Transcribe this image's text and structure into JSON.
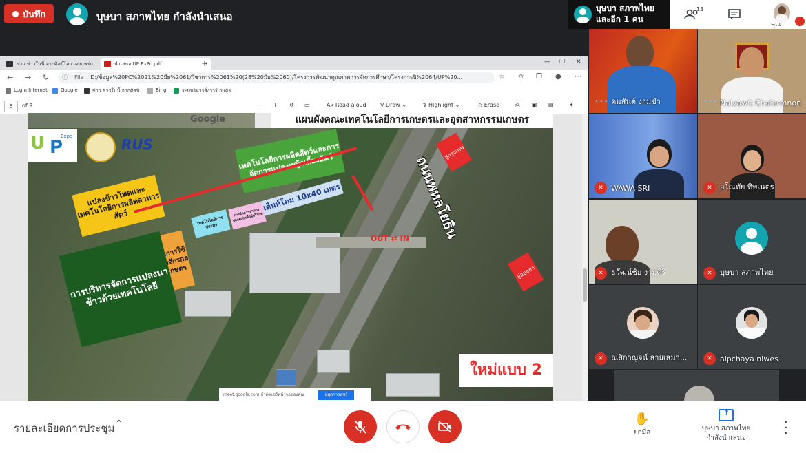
{
  "topbar": {
    "record_label": "บันทึก",
    "presenter_status": "บุษบา สภาพไทย กำลังนำเสนอ",
    "pinned": {
      "line1": "บุษบา สภาพไทย",
      "line2": "และอีก 1 คน"
    },
    "participants_count": "13",
    "me_label": "คุณ"
  },
  "browser": {
    "tabs": [
      {
        "label": "ข่าว ข่าวในนี้ จากศิลป์โลก เผยแพร่ภ..."
      },
      {
        "label": "นำเสนอ UP ExPo.pdf"
      }
    ],
    "address": {
      "prefix": "File",
      "url": "D:/ข้อมูล%20PC%2021%20มีย%2061/วิชาการ%2061%20(28%20มีย%2060)/โครงการพัฒนาคุณภาพการจัดการศึกษา/โครงการปี%2064/UP%20..."
    },
    "bookmarks": [
      "Login Internet",
      "Google",
      "ข่าว ข่าวในนี้ จากศิลป์...",
      "Bing",
      "ระบบริหารสิ่งวารีเกษตร..."
    ],
    "pdf": {
      "page": "6",
      "of": "of 9",
      "tools": [
        "Read aloud",
        "Draw",
        "Highlight",
        "Erase"
      ]
    }
  },
  "slide": {
    "google": "Google",
    "title": "แผนผังคณะเทคโนโลยีการเกษตรและอุตสาหกรรมเกษตร",
    "logo_u": "U",
    "logo_p": "P",
    "logo_expo": "Expo",
    "rus": "RUS",
    "labels": {
      "green_top": "เทคโนโลยีการผลิตสัตว์และการจัดการแปลงหญ้าเลี้ยงสัตว์",
      "yellow_left": "แปลงข้าวโพดและเทคโนโลยีการผลิตอาหารสัตว์",
      "tent": "เต็นท์โดม 10x40 เมตร",
      "cyan": "เทคโนโลยีการประมง",
      "pink": "การจัดการอาหารปลอดภัยเพื่อผู้บริโภค",
      "orange": "สาธิตการใช้เครื่องจักรกลการเกษตร",
      "green_big": "การบริหารจัดการแปลงนาข้าวด้วยเทคโนโลยี",
      "road": "ถนนพหลโยธิน",
      "out_in": "OUT ⇄ IN",
      "to_city_top": "สู่กรุงเทพ",
      "to_city_bottom": "สู่อยุธยา",
      "new_design": "ใหม่แบบ 2"
    },
    "share_bar": {
      "text": "meet.google.com กำลังแชร์หน้าจอของคุณ",
      "button": "หยุดการแชร์"
    }
  },
  "participants": [
    {
      "name": "คมสันต์ งามขำ",
      "status": "speaking"
    },
    {
      "name": "Naiyawit Chalermnon",
      "status": "speaking"
    },
    {
      "name": "WAWA SRI",
      "status": "muted"
    },
    {
      "name": "อโณทัย ทิพเนตร",
      "status": "muted"
    },
    {
      "name": "ธวัฒน์ชัย งามศิริ",
      "status": "muted"
    },
    {
      "name": "บุษบา สภาพไทย",
      "status": "muted"
    },
    {
      "name": "ณสิกาญจน์ สายเสมา...",
      "status": "muted"
    },
    {
      "name": "aipchaya niwes",
      "status": "muted"
    }
  ],
  "bottombar": {
    "meeting_details": "รายละเอียดการประชุม",
    "raise_hand": "ยกมือ",
    "presenting_line1": "บุษบา สภาพไทย",
    "presenting_line2": "กำลังนำเสนอ"
  },
  "colors": {
    "accent_red": "#d93025",
    "meet_teal": "#12a4af",
    "brand_blue": "#1a73e8"
  }
}
